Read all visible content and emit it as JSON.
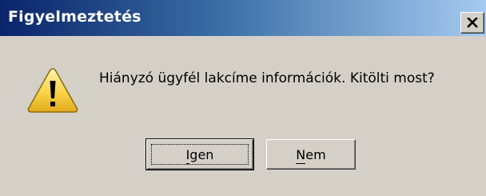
{
  "window": {
    "title": "Figyelmeztetés",
    "close_symbol": "✕"
  },
  "icon": {
    "name": "warning-icon",
    "color": "#f8d448"
  },
  "message": "Hiányzó ügyfél lakcíme információk. Kitölti most?",
  "buttons": {
    "yes_label": "Igen",
    "no_label": "Nem"
  },
  "colors": {
    "dialog_background": "#d4d0c8",
    "title_gradient_start": "#0a246a",
    "title_gradient_end": "#a6caf0"
  }
}
